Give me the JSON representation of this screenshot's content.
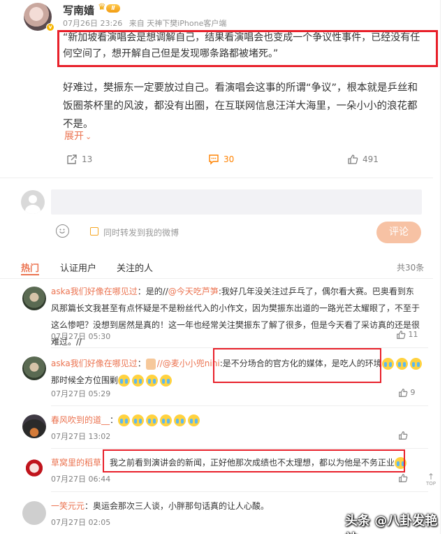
{
  "post": {
    "author": "写南嫱",
    "level_badge": "Ⅱ",
    "date": "07月26日 23:26",
    "source_prefix": "来自",
    "source": "天神下樊iPhone客户端",
    "quote": "“新加坡看演唱会是想调解自己，结果看演唱会也变成一个争议性事件，已经没有任何空间了，想开解自己但是发现哪条路都被堵死。”",
    "body": "好难过，樊振东一定要放过自己。看演唱会这事的所谓“争议”，根本就是乒丝和饭圈茶杯里的风波，都没有出圈，在互联网信息汪洋大海里，一朵小小的浪花都不是。",
    "expand_label": "展开",
    "actions": {
      "repost": "13",
      "comments": "30",
      "likes": "491"
    }
  },
  "composer": {
    "repost_label": "同时转发到我的微博",
    "reply_button": "评论"
  },
  "tabs": {
    "hot": "热门",
    "verified": "认证用户",
    "following": "关注的人",
    "total": "共30条"
  },
  "comments": [
    {
      "user": "aska我们好像在哪见过",
      "pre": "：是的//",
      "mention": "@今天吃芦笋",
      "text": ":我好几年没关注过乒乓了，偶尔看大赛。巴奥看到东风那篇长文我甚至有点怀疑是不是粉丝代入的小作文，因为樊振东出道的一路光芒太耀眼了，不至于这么惨吧？没想到居然是真的！这一年也经常关注樊振东了解了很多，但是今天看了采访真的还是很难过。//",
      "time": "07月27日 05:30",
      "likes": "11"
    },
    {
      "user": "aska我们好像在哪见过",
      "pre": "：",
      "mention": "//@麦小小兜nini",
      "text": ":是不分场合的官方化的媒体，是吃人的环境",
      "text2": "那时候全方位围剿",
      "time": "07月27日 05:29",
      "likes": "9"
    },
    {
      "user": "春风吹到的道__",
      "pre": "：",
      "time": "07月27日 13:02",
      "likes": ""
    },
    {
      "user": "草窝里的稻草",
      "pre": "：",
      "text": "我之前看到演讲会的新闻，正好他那次成绩也不太理想，都以为他是不务正业",
      "time": "07月27日 06:44",
      "likes": ""
    },
    {
      "user": "一笑元元",
      "pre": "：",
      "text": "奥运会那次三人谈，小胖那句话真的让人心酸。",
      "time": "07月27日 02:05",
      "likes": ""
    }
  ],
  "side": {
    "top_label": "TOP"
  },
  "watermark": "头条 @八卦发艳站"
}
